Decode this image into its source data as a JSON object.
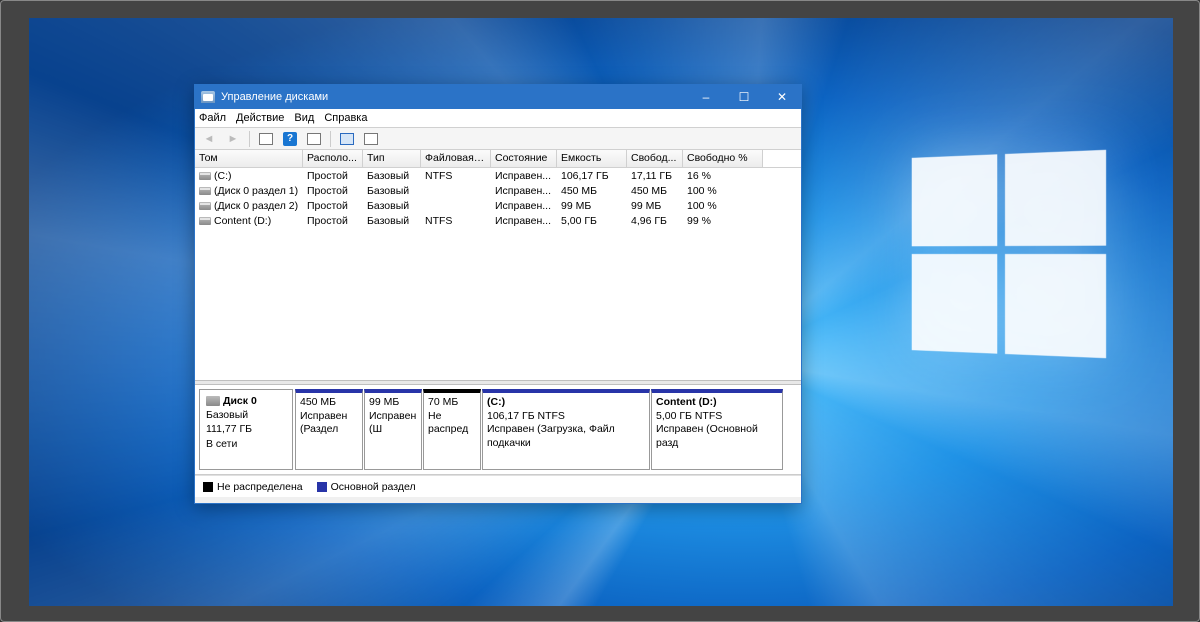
{
  "window": {
    "title": "Управление дисками",
    "controls": {
      "minimize": "–",
      "maximize": "☐",
      "close": "✕"
    }
  },
  "menu": {
    "file": "Файл",
    "action": "Действие",
    "view": "Вид",
    "help": "Справка"
  },
  "columns": {
    "volume": "Том",
    "layout": "Располо...",
    "type": "Тип",
    "fs": "Файловая с...",
    "status": "Состояние",
    "capacity": "Емкость",
    "free": "Свобод...",
    "free_pct": "Свободно %"
  },
  "volumes": [
    {
      "name": "(C:)",
      "layout": "Простой",
      "type": "Базовый",
      "fs": "NTFS",
      "status": "Исправен...",
      "capacity": "106,17 ГБ",
      "free": "17,11 ГБ",
      "free_pct": "16 %"
    },
    {
      "name": "(Диск 0 раздел 1)",
      "layout": "Простой",
      "type": "Базовый",
      "fs": "",
      "status": "Исправен...",
      "capacity": "450 МБ",
      "free": "450 МБ",
      "free_pct": "100 %"
    },
    {
      "name": "(Диск 0 раздел 2)",
      "layout": "Простой",
      "type": "Базовый",
      "fs": "",
      "status": "Исправен...",
      "capacity": "99 МБ",
      "free": "99 МБ",
      "free_pct": "100 %"
    },
    {
      "name": "Content (D:)",
      "layout": "Простой",
      "type": "Базовый",
      "fs": "NTFS",
      "status": "Исправен...",
      "capacity": "5,00 ГБ",
      "free": "4,96 ГБ",
      "free_pct": "99 %"
    }
  ],
  "disk": {
    "name": "Диск 0",
    "type": "Базовый",
    "size": "111,77 ГБ",
    "status": "В сети",
    "partitions": [
      {
        "name": "",
        "line2": "450 МБ",
        "line3": "Исправен (Раздел",
        "width": 68,
        "kind": "primary"
      },
      {
        "name": "",
        "line2": "99 МБ",
        "line3": "Исправен (Ш",
        "width": 58,
        "kind": "primary"
      },
      {
        "name": "",
        "line2": "70 МБ",
        "line3": "Не распред",
        "width": 58,
        "kind": "unalloc"
      },
      {
        "name": "(C:)",
        "line2": "106,17 ГБ NTFS",
        "line3": "Исправен (Загрузка, Файл подкачки",
        "width": 168,
        "kind": "primary"
      },
      {
        "name": "Content  (D:)",
        "line2": "5,00 ГБ NTFS",
        "line3": "Исправен (Основной разд",
        "width": 132,
        "kind": "primary"
      }
    ]
  },
  "legend": {
    "unalloc": "Не распределена",
    "primary": "Основной раздел"
  }
}
